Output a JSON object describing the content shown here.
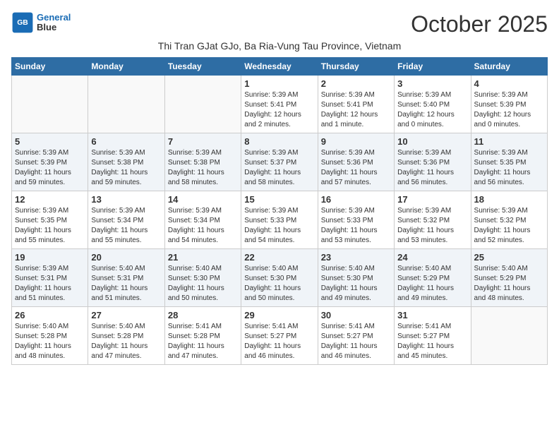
{
  "header": {
    "logo_line1": "General",
    "logo_line2": "Blue",
    "month_title": "October 2025",
    "location": "Thi Tran GJat GJo, Ba Ria-Vung Tau Province, Vietnam"
  },
  "weekdays": [
    "Sunday",
    "Monday",
    "Tuesday",
    "Wednesday",
    "Thursday",
    "Friday",
    "Saturday"
  ],
  "weeks": [
    [
      {
        "day": "",
        "info": ""
      },
      {
        "day": "",
        "info": ""
      },
      {
        "day": "",
        "info": ""
      },
      {
        "day": "1",
        "info": "Sunrise: 5:39 AM\nSunset: 5:41 PM\nDaylight: 12 hours\nand 2 minutes."
      },
      {
        "day": "2",
        "info": "Sunrise: 5:39 AM\nSunset: 5:41 PM\nDaylight: 12 hours\nand 1 minute."
      },
      {
        "day": "3",
        "info": "Sunrise: 5:39 AM\nSunset: 5:40 PM\nDaylight: 12 hours\nand 0 minutes."
      },
      {
        "day": "4",
        "info": "Sunrise: 5:39 AM\nSunset: 5:39 PM\nDaylight: 12 hours\nand 0 minutes."
      }
    ],
    [
      {
        "day": "5",
        "info": "Sunrise: 5:39 AM\nSunset: 5:39 PM\nDaylight: 11 hours\nand 59 minutes."
      },
      {
        "day": "6",
        "info": "Sunrise: 5:39 AM\nSunset: 5:38 PM\nDaylight: 11 hours\nand 59 minutes."
      },
      {
        "day": "7",
        "info": "Sunrise: 5:39 AM\nSunset: 5:38 PM\nDaylight: 11 hours\nand 58 minutes."
      },
      {
        "day": "8",
        "info": "Sunrise: 5:39 AM\nSunset: 5:37 PM\nDaylight: 11 hours\nand 58 minutes."
      },
      {
        "day": "9",
        "info": "Sunrise: 5:39 AM\nSunset: 5:36 PM\nDaylight: 11 hours\nand 57 minutes."
      },
      {
        "day": "10",
        "info": "Sunrise: 5:39 AM\nSunset: 5:36 PM\nDaylight: 11 hours\nand 56 minutes."
      },
      {
        "day": "11",
        "info": "Sunrise: 5:39 AM\nSunset: 5:35 PM\nDaylight: 11 hours\nand 56 minutes."
      }
    ],
    [
      {
        "day": "12",
        "info": "Sunrise: 5:39 AM\nSunset: 5:35 PM\nDaylight: 11 hours\nand 55 minutes."
      },
      {
        "day": "13",
        "info": "Sunrise: 5:39 AM\nSunset: 5:34 PM\nDaylight: 11 hours\nand 55 minutes."
      },
      {
        "day": "14",
        "info": "Sunrise: 5:39 AM\nSunset: 5:34 PM\nDaylight: 11 hours\nand 54 minutes."
      },
      {
        "day": "15",
        "info": "Sunrise: 5:39 AM\nSunset: 5:33 PM\nDaylight: 11 hours\nand 54 minutes."
      },
      {
        "day": "16",
        "info": "Sunrise: 5:39 AM\nSunset: 5:33 PM\nDaylight: 11 hours\nand 53 minutes."
      },
      {
        "day": "17",
        "info": "Sunrise: 5:39 AM\nSunset: 5:32 PM\nDaylight: 11 hours\nand 53 minutes."
      },
      {
        "day": "18",
        "info": "Sunrise: 5:39 AM\nSunset: 5:32 PM\nDaylight: 11 hours\nand 52 minutes."
      }
    ],
    [
      {
        "day": "19",
        "info": "Sunrise: 5:39 AM\nSunset: 5:31 PM\nDaylight: 11 hours\nand 51 minutes."
      },
      {
        "day": "20",
        "info": "Sunrise: 5:40 AM\nSunset: 5:31 PM\nDaylight: 11 hours\nand 51 minutes."
      },
      {
        "day": "21",
        "info": "Sunrise: 5:40 AM\nSunset: 5:30 PM\nDaylight: 11 hours\nand 50 minutes."
      },
      {
        "day": "22",
        "info": "Sunrise: 5:40 AM\nSunset: 5:30 PM\nDaylight: 11 hours\nand 50 minutes."
      },
      {
        "day": "23",
        "info": "Sunrise: 5:40 AM\nSunset: 5:30 PM\nDaylight: 11 hours\nand 49 minutes."
      },
      {
        "day": "24",
        "info": "Sunrise: 5:40 AM\nSunset: 5:29 PM\nDaylight: 11 hours\nand 49 minutes."
      },
      {
        "day": "25",
        "info": "Sunrise: 5:40 AM\nSunset: 5:29 PM\nDaylight: 11 hours\nand 48 minutes."
      }
    ],
    [
      {
        "day": "26",
        "info": "Sunrise: 5:40 AM\nSunset: 5:28 PM\nDaylight: 11 hours\nand 48 minutes."
      },
      {
        "day": "27",
        "info": "Sunrise: 5:40 AM\nSunset: 5:28 PM\nDaylight: 11 hours\nand 47 minutes."
      },
      {
        "day": "28",
        "info": "Sunrise: 5:41 AM\nSunset: 5:28 PM\nDaylight: 11 hours\nand 47 minutes."
      },
      {
        "day": "29",
        "info": "Sunrise: 5:41 AM\nSunset: 5:27 PM\nDaylight: 11 hours\nand 46 minutes."
      },
      {
        "day": "30",
        "info": "Sunrise: 5:41 AM\nSunset: 5:27 PM\nDaylight: 11 hours\nand 46 minutes."
      },
      {
        "day": "31",
        "info": "Sunrise: 5:41 AM\nSunset: 5:27 PM\nDaylight: 11 hours\nand 45 minutes."
      },
      {
        "day": "",
        "info": ""
      }
    ]
  ]
}
